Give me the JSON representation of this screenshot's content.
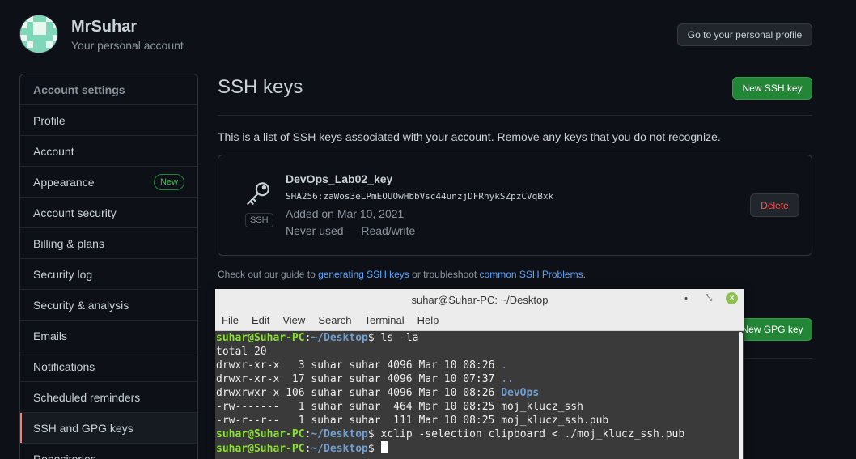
{
  "account": {
    "name": "MrSuhar",
    "subtitle": "Your personal account",
    "profile_button": "Go to your personal profile"
  },
  "sidebar": {
    "heading": "Account settings",
    "items": [
      {
        "label": "Profile"
      },
      {
        "label": "Account"
      },
      {
        "label": "Appearance",
        "badge": "New"
      },
      {
        "label": "Account security"
      },
      {
        "label": "Billing & plans"
      },
      {
        "label": "Security log"
      },
      {
        "label": "Security & analysis"
      },
      {
        "label": "Emails"
      },
      {
        "label": "Notifications"
      },
      {
        "label": "Scheduled reminders"
      },
      {
        "label": "SSH and GPG keys"
      },
      {
        "label": "Repositories"
      }
    ]
  },
  "main": {
    "title": "SSH keys",
    "new_ssh_button": "New SSH key",
    "intro": "This is a list of SSH keys associated with your account. Remove any keys that you do not recognize.",
    "key": {
      "title": "DevOps_Lab02_key",
      "fingerprint": "SHA256:zaWos3eLPmEOUOwHbbVsc44unzjDFRnykSZpzCVqBxk",
      "added": "Added on Mar 10, 2021",
      "usage": "Never used — Read/write",
      "badge": "SSH",
      "delete_button": "Delete"
    },
    "guide": {
      "prefix": "Check out our guide to ",
      "link1": "generating SSH keys",
      "middle": " or troubleshoot ",
      "link2": "common SSH Problems",
      "suffix": "."
    },
    "new_gpg_button": "New GPG key"
  },
  "terminal": {
    "title": "suhar@Suhar-PC: ~/Desktop",
    "controls": {
      "minimize": "•",
      "maximize": "⤡",
      "close": "×"
    },
    "menu": [
      "File",
      "Edit",
      "View",
      "Search",
      "Terminal",
      "Help"
    ],
    "prompt_user": "suhar@Suhar-PC",
    "prompt_sep": ":",
    "prompt_path": "~/Desktop",
    "prompt_end": "$ ",
    "cmd1": "ls -la",
    "total": "total 20",
    "ls_rows": [
      {
        "text": "drwxr-xr-x   3 suhar suhar 4096 Mar 10 08:26 ",
        "name": ".",
        "cls": "dir"
      },
      {
        "text": "drwxr-xr-x  17 suhar suhar 4096 Mar 10 07:37 ",
        "name": "..",
        "cls": "dir"
      },
      {
        "text": "drwxrwxr-x 106 suhar suhar 4096 Mar 10 08:26 ",
        "name": "DevOps",
        "cls": "dir-b"
      },
      {
        "text": "-rw-------   1 suhar suhar  464 Mar 10 08:25 ",
        "name": "moj_klucz_ssh",
        "cls": ""
      },
      {
        "text": "-rw-r--r--   1 suhar suhar  111 Mar 10 08:25 ",
        "name": "moj_klucz_ssh.pub",
        "cls": ""
      }
    ],
    "cmd2": "xclip -selection clipboard < ./moj_klucz_ssh.pub"
  }
}
